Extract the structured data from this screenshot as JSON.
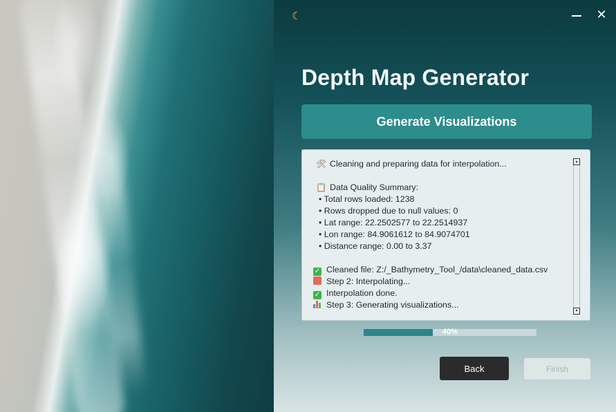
{
  "window": {
    "theme_icon": "moon-icon",
    "minimize_icon": "minimize-icon",
    "close_icon": "close-icon",
    "close_glyph": "✕"
  },
  "app": {
    "title": "Depth Map Generator",
    "generate_label": "Generate Visualizations"
  },
  "log": {
    "lines": [
      {
        "icon": "tools-icon",
        "text": "Cleaning and preparing data for interpolation..."
      },
      {
        "icon": "",
        "text": ""
      },
      {
        "icon": "clipboard-icon",
        "text": "Data Quality Summary:"
      },
      {
        "icon": "",
        "text": "• Total rows loaded: 1238"
      },
      {
        "icon": "",
        "text": "• Rows dropped due to null values: 0"
      },
      {
        "icon": "",
        "text": "• Lat range: 22.2502577 to 22.2514937"
      },
      {
        "icon": "",
        "text": "• Lon range: 84.9061612 to 84.9074701"
      },
      {
        "icon": "",
        "text": "• Distance range: 0.00 to 3.37"
      },
      {
        "icon": "",
        "text": ""
      },
      {
        "icon": "check-icon",
        "text": "Cleaned file: Z:/_Bathymetry_Tool_/data\\cleaned_data.csv"
      },
      {
        "icon": "abacus-icon",
        "text": "Step 2: Interpolating..."
      },
      {
        "icon": "check-icon",
        "text": "Interpolation done."
      },
      {
        "icon": "bar-chart-icon",
        "text": "Step 3: Generating visualizations..."
      }
    ]
  },
  "progress": {
    "value": 0.4,
    "label": "40%"
  },
  "nav": {
    "back_label": "Back",
    "finish_label": "Finish"
  },
  "colors": {
    "accent": "#2d8c8c",
    "progress_fill": "#2d8589",
    "back_button": "#2b2b2b",
    "finish_disabled": "#dfe6e6"
  }
}
